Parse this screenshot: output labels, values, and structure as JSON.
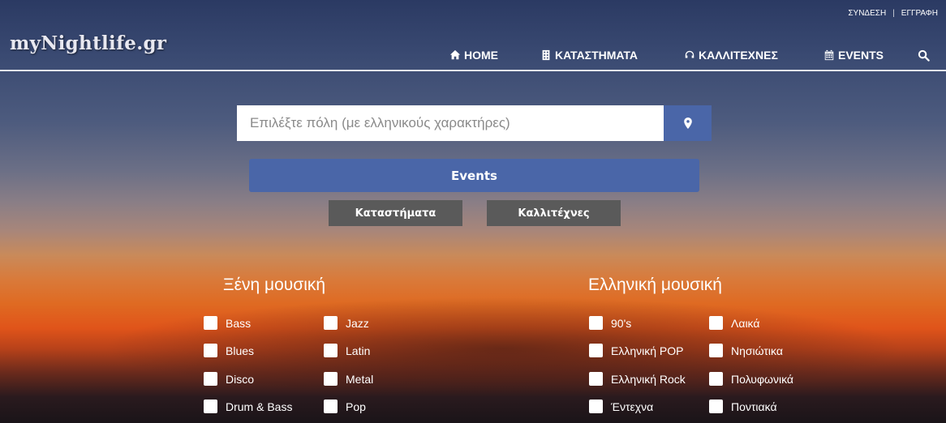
{
  "header": {
    "logo": "myNightlife.gr",
    "auth": {
      "login": "ΣΥΝΔΕΣΗ",
      "separator": "|",
      "register": "ΕΓΓΡΑΦΗ"
    },
    "nav": [
      {
        "label": "HOME",
        "icon": "home-icon"
      },
      {
        "label": "ΚΑΤΑΣΤΗΜΑΤΑ",
        "icon": "building-icon"
      },
      {
        "label": "ΚΑΛΛΙΤΕΧΝΕΣ",
        "icon": "headphones-icon"
      },
      {
        "label": "EVENTS",
        "icon": "calendar-icon"
      }
    ],
    "search_icon": "search-icon"
  },
  "search": {
    "placeholder": "Επιλέξτε πόλη (με ελληνικούς χαρακτήρες)",
    "location_icon": "map-marker-icon",
    "events_label": "Events",
    "stores_label": "Καταστήματα",
    "artists_label": "Καλλιτέχνες"
  },
  "foreign_music": {
    "title": "Ξένη μουσική",
    "col1": [
      "Bass",
      "Blues",
      "Disco",
      "Drum & Bass"
    ],
    "col2": [
      "Jazz",
      "Latin",
      "Metal",
      "Pop"
    ]
  },
  "greek_music": {
    "title": "Ελληνική μουσική",
    "col1": [
      "90's",
      "Ελληνική POP",
      "Ελληνική Rock",
      "Έντεχνα"
    ],
    "col2": [
      "Λαικά",
      "Νησιώτικα",
      "Πολυφωνικά",
      "Ποντιακά"
    ]
  },
  "colors": {
    "accent": "#4a66a8",
    "secondary_button": "#5a5a5a"
  }
}
